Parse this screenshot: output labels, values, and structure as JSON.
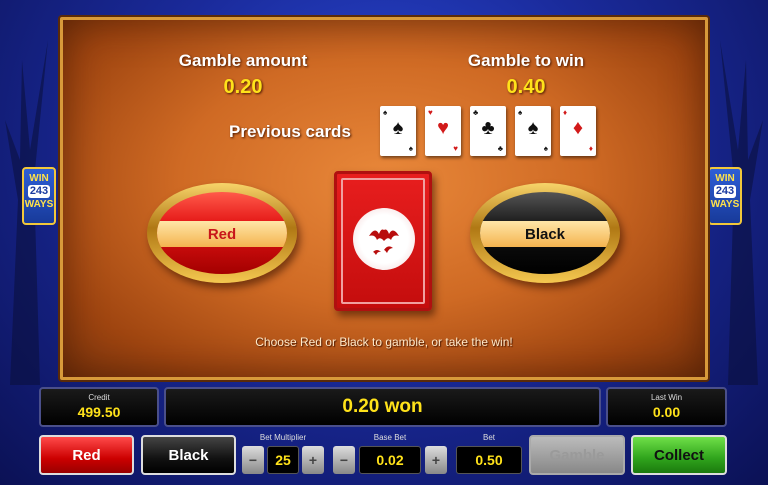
{
  "gamble": {
    "amount_label": "Gamble amount",
    "amount_value": "0.20",
    "to_win_label": "Gamble to win",
    "to_win_value": "0.40",
    "previous_cards_label": "Previous cards",
    "previous_cards": [
      {
        "suit": "♠",
        "color": "black"
      },
      {
        "suit": "♥",
        "color": "red"
      },
      {
        "suit": "♣",
        "color": "black"
      },
      {
        "suit": "♠",
        "color": "black"
      },
      {
        "suit": "♦",
        "color": "red"
      }
    ],
    "red_choice_label": "Red",
    "black_choice_label": "Black",
    "instruction": "Choose Red or Black to gamble, or take the win!"
  },
  "side_logo": {
    "line1": "WIN",
    "line2": "243",
    "line3": "WAYS"
  },
  "info_bar": {
    "credit_label": "Credit",
    "credit_value": "499.50",
    "win_text": "0.20 won",
    "last_win_label": "Last Win",
    "last_win_value": "0.00"
  },
  "controls": {
    "red_label": "Red",
    "black_label": "Black",
    "bet_multiplier_label": "Bet Multiplier",
    "bet_multiplier_value": "25",
    "base_bet_label": "Base Bet",
    "base_bet_value": "0.02",
    "bet_label": "Bet",
    "bet_value": "0.50",
    "gamble_label": "Gamble",
    "collect_label": "Collect",
    "minus_glyph": "−",
    "plus_glyph": "+"
  },
  "colors": {
    "accent_yellow": "#ffe21a",
    "panel_orange": "#cf6a24",
    "card_red": "#d21a1a",
    "collect_green": "#2fa31c"
  }
}
